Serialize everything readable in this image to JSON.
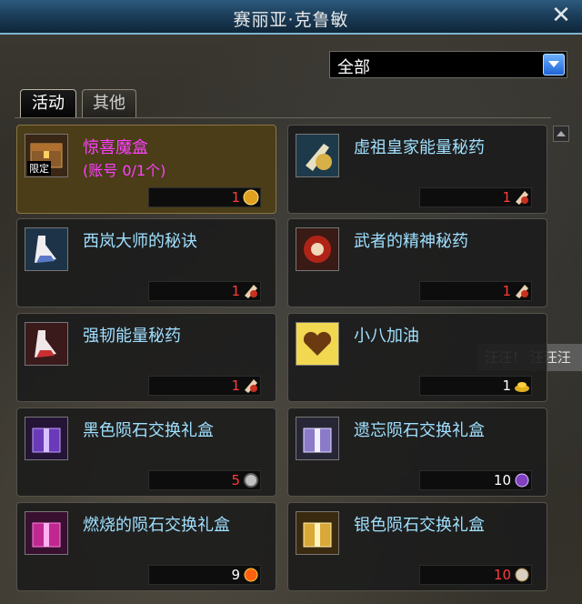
{
  "window": {
    "title": "赛丽亚·克鲁敏"
  },
  "filter": {
    "selected": "全部"
  },
  "tabs": [
    {
      "label": "活动",
      "active": true
    },
    {
      "label": "其他",
      "active": false
    }
  ],
  "items": [
    {
      "name": "惊喜魔盒",
      "sub": "(账号 0/1个)",
      "badge": "限定",
      "price": "1",
      "price_color": "#ff3b3b",
      "currency_icon": "gold-coin-icon",
      "icon": "treasure-chest-icon",
      "highlight": true
    },
    {
      "name": "虚祖皇家能量秘药",
      "price": "1",
      "price_color": "#ff3b3b",
      "currency_icon": "ticket-icon",
      "icon": "potion-bottle-icon"
    },
    {
      "name": "西岚大师的秘诀",
      "price": "1",
      "price_color": "#ff3b3b",
      "currency_icon": "ticket-icon",
      "icon": "potion-flask-icon"
    },
    {
      "name": "武者的精神秘药",
      "price": "1",
      "price_color": "#ff3b3b",
      "currency_icon": "ticket-icon",
      "icon": "spirit-orb-icon"
    },
    {
      "name": "强韧能量秘药",
      "price": "1",
      "price_color": "#ff3b3b",
      "currency_icon": "ticket-icon",
      "icon": "potion-flask-red-icon"
    },
    {
      "name": "小八加油",
      "price": "1",
      "price_color": "#ffffff",
      "currency_icon": "gold-pile-icon",
      "icon": "heart-icon"
    },
    {
      "name": "黑色陨石交换礼盒",
      "price": "5",
      "price_color": "#ff3b3b",
      "currency_icon": "silver-gear-icon",
      "icon": "purple-giftbox-icon"
    },
    {
      "name": "遗忘陨石交换礼盒",
      "price": "10",
      "price_color": "#ffffff",
      "currency_icon": "purple-orb-icon",
      "icon": "purple-silver-giftbox-icon"
    },
    {
      "name": "燃烧的陨石交换礼盒",
      "price": "9",
      "price_color": "#ffffff",
      "currency_icon": "fire-orb-icon",
      "icon": "magenta-giftbox-icon"
    },
    {
      "name": "银色陨石交换礼盒",
      "price": "10",
      "price_color": "#ff3b3b",
      "currency_icon": "silver-orb-icon",
      "icon": "gold-giftbox-icon"
    }
  ],
  "background_text": {
    "edge_label": "汪汪！ 汪汪汪"
  }
}
